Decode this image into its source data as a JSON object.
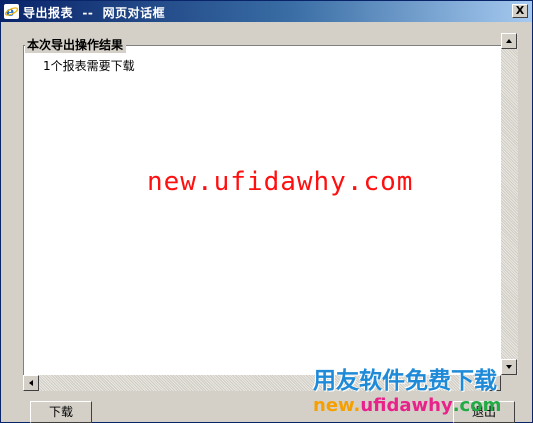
{
  "window": {
    "title": "导出报表  --  网页对话框",
    "close_label": "X"
  },
  "group": {
    "legend": "本次导出操作结果",
    "message": "1个报表需要下载"
  },
  "buttons": {
    "download_label": "下载",
    "exit_label": "退出"
  },
  "watermarks": {
    "center_text": "new.ufidawhy.com",
    "corner_title": "用友软件免费下载",
    "corner_url_parts": [
      "new.",
      "ufidawhy",
      ".com"
    ],
    "colors": {
      "center": "#ff1010",
      "corner_title": "#1e8ad8",
      "url_new": "#f5a000",
      "url_domain": "#e8228a",
      "url_com": "#22aa44"
    }
  },
  "icons": [
    "ie-icon",
    "close-icon",
    "arrow-up-icon",
    "arrow-down-icon",
    "arrow-left-icon",
    "arrow-right-icon"
  ]
}
